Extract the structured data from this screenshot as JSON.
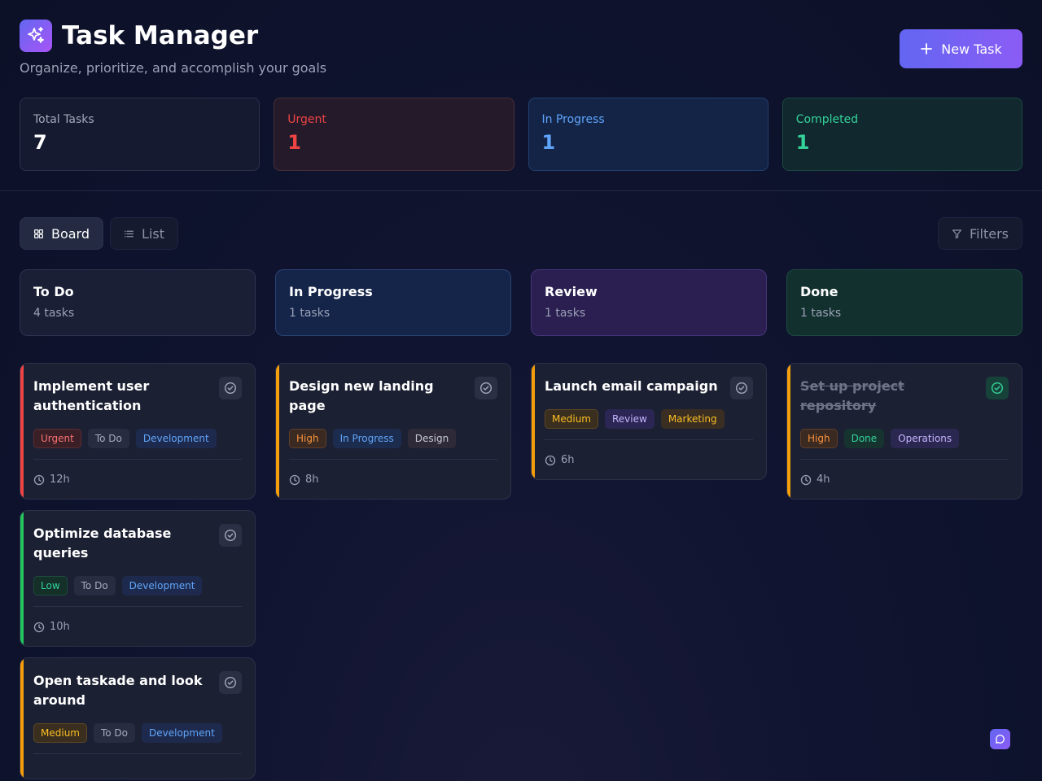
{
  "header": {
    "title": "Task Manager",
    "subtitle": "Organize, prioritize, and accomplish your goals",
    "new_task_label": "New Task"
  },
  "stats": [
    {
      "label": "Total Tasks",
      "value": "7"
    },
    {
      "label": "Urgent",
      "value": "1"
    },
    {
      "label": "In Progress",
      "value": "1"
    },
    {
      "label": "Completed",
      "value": "1"
    }
  ],
  "toolbar": {
    "board_label": "Board",
    "list_label": "List",
    "filters_label": "Filters"
  },
  "columns": [
    {
      "title": "To Do",
      "count": "4 tasks",
      "cards": [
        {
          "title": "Implement user authentication",
          "priority": "Urgent",
          "status": "To Do",
          "category": "Development",
          "time": "12h"
        },
        {
          "title": "Optimize database queries",
          "priority": "Low",
          "status": "To Do",
          "category": "Development",
          "time": "10h"
        },
        {
          "title": "Open taskade and look around",
          "priority": "Medium",
          "status": "To Do",
          "category": "Development",
          "time": ""
        }
      ]
    },
    {
      "title": "In Progress",
      "count": "1 tasks",
      "cards": [
        {
          "title": "Design new landing page",
          "priority": "High",
          "status": "In Progress",
          "category": "Design",
          "time": "8h"
        }
      ]
    },
    {
      "title": "Review",
      "count": "1 tasks",
      "cards": [
        {
          "title": "Launch email campaign",
          "priority": "Medium",
          "status": "Review",
          "category": "Marketing",
          "time": "6h"
        }
      ]
    },
    {
      "title": "Done",
      "count": "1 tasks",
      "cards": [
        {
          "title": "Set up project repository",
          "priority": "High",
          "status": "Done",
          "category": "Operations",
          "time": "4h"
        }
      ]
    }
  ],
  "colors": {
    "accent": "#6366f1",
    "urgent": "#ef4444",
    "high": "#f59e0b",
    "low": "#22c55e"
  }
}
